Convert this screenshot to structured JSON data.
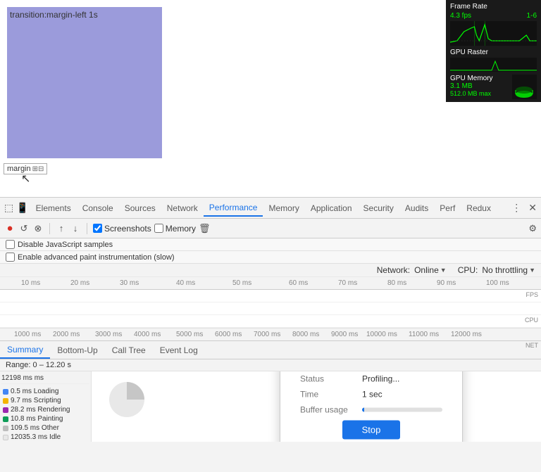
{
  "browser": {
    "transition_label": "transition:margin-left 1s",
    "margin_tooltip": "margin",
    "blue_box_color": "#9b9bdb"
  },
  "frame_rate": {
    "title": "Frame Rate",
    "fps_label": "4.3 fps",
    "fps_value_right": "1-6",
    "gpu_raster_label": "GPU Raster",
    "gpu_memory_label": "GPU Memory",
    "gpu_memory_value1": "3.1 MB",
    "gpu_memory_value2": "512.0 MB max"
  },
  "devtools": {
    "tabs": [
      "Elements",
      "Console",
      "Sources",
      "Network",
      "Performance",
      "Memory",
      "Application",
      "Security",
      "Audits",
      "Perf",
      "Redux"
    ],
    "active_tab": "Performance",
    "toolbar": {
      "record_label": "●",
      "refresh_label": "↺",
      "stop_label": "⊗",
      "up_label": "↑",
      "down_label": "↓",
      "screenshots_label": "Screenshots",
      "memory_label": "Memory",
      "trash_label": "🗑"
    },
    "settings": {
      "disable_js_samples": "Disable JavaScript samples",
      "enable_advanced_paint": "Enable advanced paint instrumentation (slow)"
    },
    "network": {
      "label": "Network:",
      "value": "Online",
      "cpu_label": "CPU:",
      "cpu_value": "No throttling"
    },
    "ruler_ticks": [
      "10 ms",
      "20 ms",
      "30 ms",
      "40 ms",
      "50 ms",
      "60 ms",
      "70 ms",
      "80 ms",
      "90 ms",
      "100 ms"
    ],
    "strip_labels": [
      "FPS",
      "CPU",
      "NET"
    ],
    "bottom_ruler_ticks": [
      "1000 ms",
      "2000 ms",
      "3000 ms",
      "4000 ms",
      "5000 ms",
      "6000 ms",
      "7000 ms",
      "8000 ms",
      "9000 ms",
      "10000 ms",
      "11000 ms",
      "12000 ms"
    ],
    "bottom_tabs": [
      "Summary",
      "Bottom-Up",
      "Call Tree",
      "Event Log"
    ],
    "active_bottom_tab": "Summary",
    "range": "Range: 0 – 12.20 s",
    "entries": [
      {
        "label": "0.5 ms  Loading",
        "color": "#4285f4"
      },
      {
        "label": "9.7 ms  Scripting",
        "color": "#f4b400"
      },
      {
        "label": "28.2 ms  Rendering",
        "color": "#9c27b0"
      },
      {
        "label": "10.8 ms  Painting",
        "color": "#0f9d58"
      },
      {
        "label": "109.5 ms  Other",
        "color": "#bdbdbd"
      },
      {
        "label": "12035.3 ms  Idle",
        "color": "#f5f5f5"
      }
    ],
    "left_time_label": "12198 ms"
  },
  "dialog": {
    "status_label": "Status",
    "status_value": "Profiling...",
    "time_label": "Time",
    "time_value": "1 sec",
    "buffer_label": "Buffer usage",
    "stop_button": "Stop"
  }
}
